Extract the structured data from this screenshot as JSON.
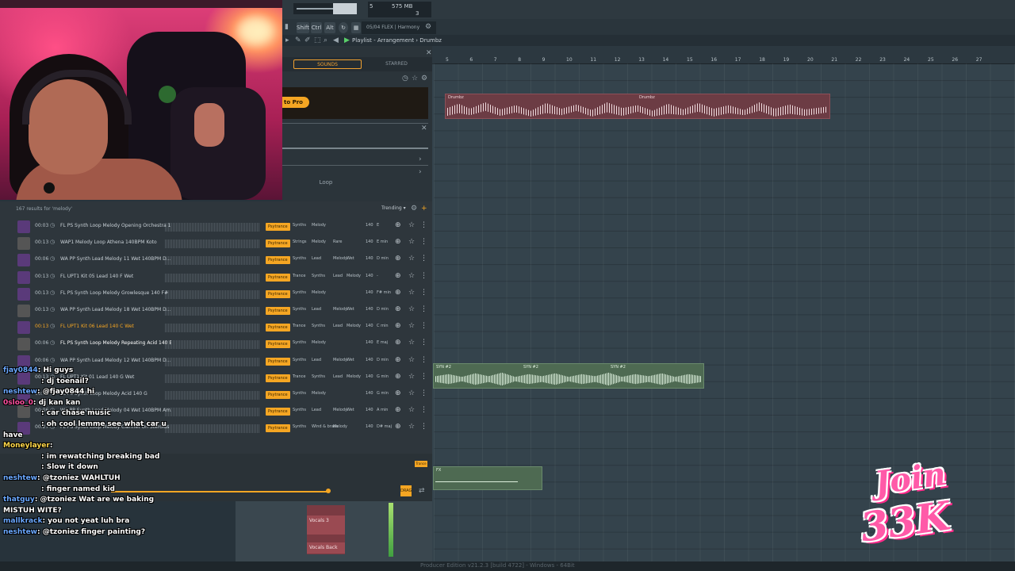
{
  "topbar": {
    "cpu_mb": "575 MB",
    "cpu_num1": "5",
    "cpu_num2": "3",
    "hint_text": "05/04 FLEX | Harmony",
    "shift_label": "Shift",
    "ctrl_label": "Ctrl",
    "alt_label": "Alt"
  },
  "playlist": {
    "title": "Playlist - Arrangement › Drumbz",
    "bar_numbers": [
      "5",
      "6",
      "7",
      "8",
      "9",
      "10",
      "11",
      "12",
      "13",
      "14",
      "15",
      "16",
      "17",
      "18",
      "19",
      "20",
      "21",
      "22",
      "23",
      "24",
      "25",
      "26",
      "27"
    ],
    "clip_drums_label_a": "Drumbz",
    "clip_drums_label_b": "Drumbz",
    "clip_melody_label_a": "SYN #2",
    "clip_melody_label_b": "SYN #2",
    "clip_melody_label_c": "SYN #2",
    "clip_fx_label": "FX"
  },
  "browser": {
    "tab_sounds": "SOUNDS",
    "tab_starred": "STARRED",
    "promo_button": "to Pro",
    "loop_label": "Loop",
    "results_count": "167 results for 'melody'",
    "sort_label": "Trending"
  },
  "rows": [
    {
      "dur": "00:03",
      "name": "FL PS Synth Loop Melody Opening Orchestra 1...",
      "genre": "Psytrance",
      "t1": "Synths",
      "t2": "Melody",
      "t3": "",
      "t4": "",
      "bpm": "140",
      "key": "E"
    },
    {
      "dur": "00:13",
      "name": "WAP1 Melody Loop Athena 140BPM Koto",
      "genre": "Psytrance",
      "t1": "Strings",
      "t2": "Melody",
      "t3": "Rare",
      "t4": "",
      "bpm": "140",
      "key": "E min"
    },
    {
      "dur": "00:06",
      "name": "WA PP Synth Lead Melody 11 Wet 140BPM D...",
      "genre": "Psytrance",
      "t1": "Synths",
      "t2": "Lead",
      "t3": "Melody",
      "t4": "Wet",
      "bpm": "140",
      "key": "D min"
    },
    {
      "dur": "00:13",
      "name": "FL UPT1 Kit 05 Lead 140 F Wet",
      "genre": "Psytrance",
      "t1": "Trance",
      "t2": "Synths",
      "t3": "Lead",
      "t4": "Melody",
      "bpm": "140",
      "key": "-"
    },
    {
      "dur": "00:13",
      "name": "FL PS Synth Loop Melody Growlesque 140 F#",
      "genre": "Psytrance",
      "t1": "Synths",
      "t2": "Melody",
      "t3": "",
      "t4": "",
      "bpm": "140",
      "key": "F# min"
    },
    {
      "dur": "00:13",
      "name": "WA PP Synth Lead Melody 18 Wet 140BPM D...",
      "genre": "Psytrance",
      "t1": "Synths",
      "t2": "Lead",
      "t3": "Melody",
      "t4": "Wet",
      "bpm": "140",
      "key": "D min"
    },
    {
      "dur": "00:13",
      "name": "FL UPT1 Kit 06 Lead 140 C Wet",
      "genre": "Psytrance",
      "t1": "Trance",
      "t2": "Synths",
      "t3": "Lead",
      "t4": "Melody",
      "bpm": "140",
      "key": "C min"
    },
    {
      "dur": "00:06",
      "name": "FL PS Synth Loop Melody Repeating Acid 140 E",
      "genre": "Psytrance",
      "t1": "Synths",
      "t2": "Melody",
      "t3": "",
      "t4": "",
      "bpm": "140",
      "key": "E maj"
    },
    {
      "dur": "00:06",
      "name": "WA PP Synth Lead Melody 12 Wet 140BPM D...",
      "genre": "Psytrance",
      "t1": "Synths",
      "t2": "Lead",
      "t3": "Melody",
      "t4": "Wet",
      "bpm": "140",
      "key": "D min"
    },
    {
      "dur": "00:13",
      "name": "FL UPT1 Kit 01 Lead 140 G Wet",
      "genre": "Psytrance",
      "t1": "Trance",
      "t2": "Synths",
      "t3": "Lead",
      "t4": "Melody",
      "bpm": "140",
      "key": "G min"
    },
    {
      "dur": "00:13",
      "name": "FL PS Synth Loop Melody Acid 140 G",
      "genre": "Psytrance",
      "t1": "Synths",
      "t2": "Melody",
      "t3": "",
      "t4": "",
      "bpm": "140",
      "key": "G min"
    },
    {
      "dur": "00:06",
      "name": "WA PP Synth Lead Melody 04 Wet 140BPM Am...",
      "genre": "Psytrance",
      "t1": "Synths",
      "t2": "Lead",
      "t3": "Melody",
      "t4": "Wet",
      "bpm": "140",
      "key": "A min"
    },
    {
      "dur": "00:27",
      "name": "FL PS Synth Loop Melody Clarinet On Steroids",
      "genre": "Psytrance",
      "t1": "Synths",
      "t2": "Wind & brass",
      "t3": "Melody",
      "t4": "",
      "bpm": "140",
      "key": "D# maj"
    }
  ],
  "player": {
    "track_badge": "Trance",
    "btn_label": "DRAG"
  },
  "mixer": {
    "track1": "Vocals 3",
    "track2": "Vocals Back"
  },
  "status": {
    "text": "Producer Edition v21.2.3 [build 4722] - Windows - 64Bit"
  },
  "chat": [
    {
      "user": "fjay0844",
      "msg": ": Hi guys",
      "color": "blue"
    },
    {
      "user": "",
      "msg": ": dj toenail?",
      "color": "blue"
    },
    {
      "user": "neshtew",
      "msg": ": @fjay0844 hi",
      "color": "blue"
    },
    {
      "user": "0sloo_0",
      "msg": ": dj kan kan",
      "color": "pink"
    },
    {
      "user": "",
      "msg": ": car chase music",
      "color": "blue"
    },
    {
      "user": "",
      "msg": ": oh cool lemme see what car u",
      "color": "blue"
    },
    {
      "user": "",
      "msg": "have",
      "color": "blue"
    },
    {
      "user": "Moneylayer",
      "msg": ":",
      "color": "gold"
    },
    {
      "user": "",
      "msg": ": im rewatching breaking bad",
      "color": "blue"
    },
    {
      "user": "",
      "msg": ": Slow it down",
      "color": "blue"
    },
    {
      "user": "neshtew",
      "msg": ": @tzoniez WAHLTUH",
      "color": "blue"
    },
    {
      "user": "",
      "msg": ": finger named kid",
      "color": "blue"
    },
    {
      "user": "thatguy",
      "msg": ": @tzoniez Wat are we baking",
      "color": "blue"
    },
    {
      "user": "",
      "msg": "MISTUH WITE?",
      "color": "blue"
    },
    {
      "user": "mallkrack",
      "msg": ": you not yeat luh bra",
      "color": "blue"
    },
    {
      "user": "neshtew",
      "msg": ": @tzoniez finger painting?",
      "color": "blue"
    }
  ],
  "overlay": {
    "join_line1": "Join",
    "join_line2": "33K"
  }
}
